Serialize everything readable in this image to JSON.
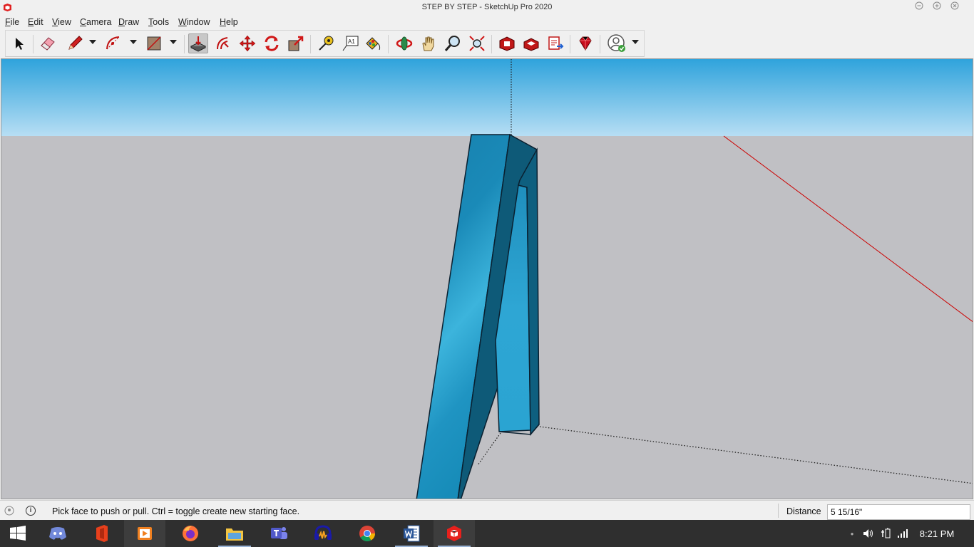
{
  "window": {
    "title": "STEP BY STEP - SketchUp Pro 2020",
    "controls": [
      "minimize",
      "maximize",
      "close"
    ]
  },
  "menu": {
    "items": [
      "File",
      "Edit",
      "View",
      "Camera",
      "Draw",
      "Tools",
      "Window",
      "Help"
    ]
  },
  "toolbar": {
    "tools": [
      {
        "name": "select",
        "icon": "arrow-icon"
      },
      {
        "name": "eraser",
        "icon": "eraser-icon"
      },
      {
        "name": "line",
        "icon": "pencil-icon"
      },
      {
        "name": "arc",
        "icon": "arc-icon"
      },
      {
        "name": "rectangle",
        "icon": "rectangle-icon"
      },
      {
        "name": "push-pull",
        "icon": "pushpull-icon",
        "active": true
      },
      {
        "name": "offset",
        "icon": "offset-icon"
      },
      {
        "name": "move",
        "icon": "move-icon"
      },
      {
        "name": "rotate",
        "icon": "rotate-icon"
      },
      {
        "name": "scale",
        "icon": "scale-icon"
      },
      {
        "name": "tape-measure",
        "icon": "tape-icon"
      },
      {
        "name": "text",
        "icon": "text-icon"
      },
      {
        "name": "paint-bucket",
        "icon": "paint-icon"
      },
      {
        "name": "orbit",
        "icon": "orbit-icon"
      },
      {
        "name": "pan",
        "icon": "hand-icon"
      },
      {
        "name": "zoom",
        "icon": "zoom-icon"
      },
      {
        "name": "zoom-extents",
        "icon": "zoom-extents-icon"
      },
      {
        "name": "3d-warehouse",
        "icon": "warehouse-icon"
      },
      {
        "name": "extension-warehouse",
        "icon": "extension-icon"
      },
      {
        "name": "send-to-layout",
        "icon": "layout-icon"
      },
      {
        "name": "ruby",
        "icon": "ruby-icon"
      },
      {
        "name": "account",
        "icon": "user-icon"
      }
    ],
    "text_tool_glyph": "A1"
  },
  "status": {
    "hint": "Pick face to push or pull.  Ctrl = toggle create new starting face.",
    "distance_label": "Distance",
    "distance_value": "5 15/16\""
  },
  "taskbar": {
    "apps": [
      "Windows Start",
      "Discord",
      "Microsoft Office",
      "VLC",
      "Firefox",
      "File Explorer",
      "Microsoft Teams",
      "Audacity",
      "Google Chrome",
      "Microsoft Word",
      "SketchUp"
    ],
    "clock": "8:21 PM"
  },
  "colors": {
    "sky_top": "#2fa3dc",
    "sky_bottom": "#b7def4",
    "ground": "#c0c0c4",
    "model_face": "#1c8bb5",
    "red_axis": "#cc0000",
    "taskbar": "#2f2f2f"
  }
}
